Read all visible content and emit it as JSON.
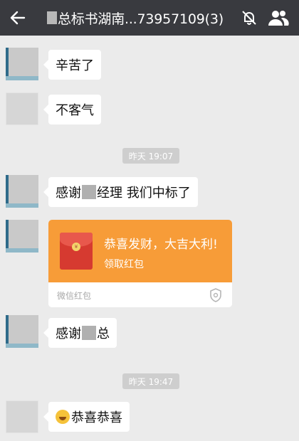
{
  "header": {
    "title": "总标书湖南...73957109(3)"
  },
  "icons": {
    "back": "back-arrow-icon",
    "mute": "mute-bell-icon",
    "members": "group-members-icon"
  },
  "messages": [
    {
      "text": "辛苦了"
    },
    {
      "text": "不客气"
    },
    {
      "time": "昨天 19:07"
    },
    {
      "text_before": "感谢",
      "text_after": "经理 我们中标了"
    },
    {
      "red_packet": {
        "greeting": "恭喜发财，大吉大利!",
        "action": "领取红包",
        "source": "微信红包"
      }
    },
    {
      "text_before": "感谢",
      "text_after": "总"
    },
    {
      "time": "昨天 19:47"
    },
    {
      "text": "恭喜恭喜"
    }
  ],
  "colors": {
    "title_bar": "#393a3f",
    "chat_background": "#ebebeb",
    "red_packet": "#f79c38"
  }
}
